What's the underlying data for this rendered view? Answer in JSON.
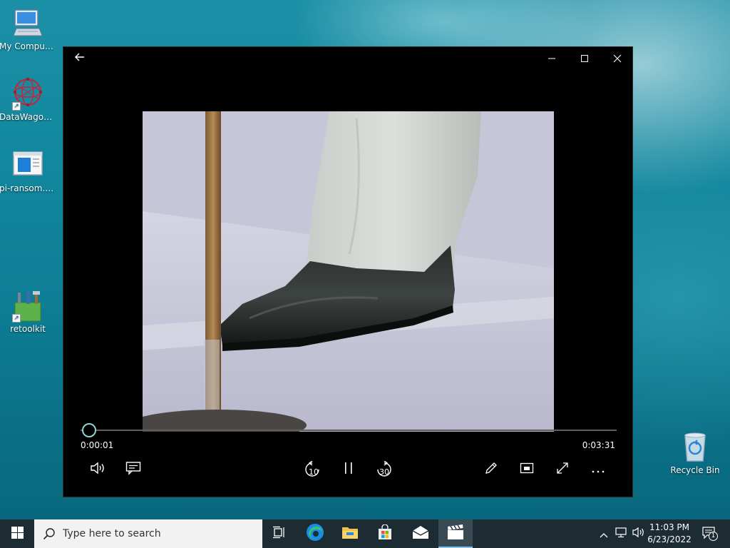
{
  "desktop": {
    "icons": [
      {
        "label": "My Computer",
        "icon": "monitor-icon"
      },
      {
        "label": "DataWagon...",
        "icon": "network-sphere-icon"
      },
      {
        "label": "pi-ransom.p...",
        "icon": "document-window-icon"
      },
      {
        "label": "retoolkit",
        "icon": "toolkit-icon"
      },
      {
        "label": "Recycle Bin",
        "icon": "recycle-bin-icon"
      }
    ]
  },
  "player": {
    "back_icon": "arrow-left-icon",
    "window_controls": [
      "minimize-icon",
      "maximize-icon",
      "close-icon"
    ],
    "elapsed": "0:00:01",
    "total": "0:03:31",
    "progress": 0.005,
    "skip_back_label": "10",
    "skip_forward_label": "30",
    "controls_left": [
      "volume-icon",
      "subtitles-icon"
    ],
    "controls_center": [
      "skip-back-10-icon",
      "pause-icon",
      "skip-forward-30-icon"
    ],
    "controls_right": [
      "edit-pencil-icon",
      "mini-view-icon",
      "fullscreen-icon",
      "more-options-icon"
    ],
    "accent": "#8fd3d6"
  },
  "taskbar": {
    "search_placeholder": "Type here to search",
    "apps": [
      "task-view-icon",
      "edge-icon",
      "file-explorer-icon",
      "store-icon",
      "mail-icon",
      "movies-tv-icon"
    ],
    "tray_icons": [
      "chevron-up-icon",
      "network-icon",
      "speaker-icon"
    ],
    "time": "11:03 PM",
    "date": "6/23/2022",
    "notification_count": "1",
    "background": "#1d2b33"
  }
}
